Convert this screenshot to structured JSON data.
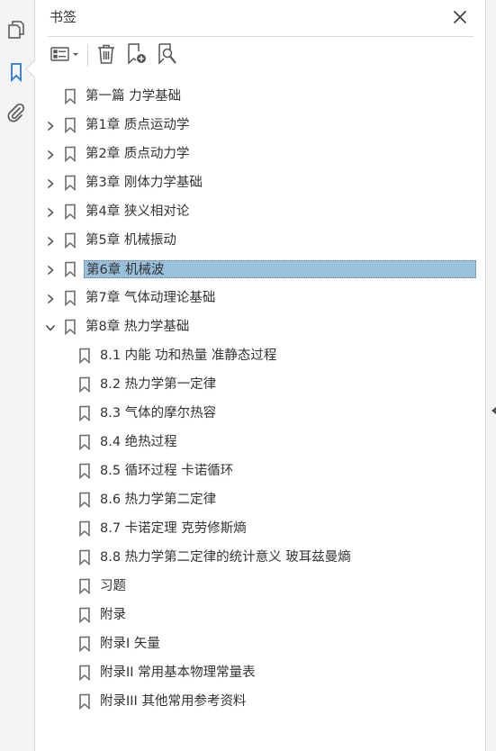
{
  "panel": {
    "title": "书签"
  },
  "rail": {
    "icons": [
      "pages-icon",
      "bookmark-icon",
      "attachment-icon"
    ]
  },
  "toolbar": {
    "buttons": [
      "options-menu-icon",
      "delete-bookmark-icon",
      "new-bookmark-icon",
      "find-bookmark-icon"
    ]
  },
  "bookmarks": [
    {
      "label": "第一篇  力学基础",
      "level": 0,
      "expander": "none"
    },
    {
      "label": "第1章  质点运动学",
      "level": 0,
      "expander": "collapsed"
    },
    {
      "label": "第2章  质点动力学",
      "level": 0,
      "expander": "collapsed"
    },
    {
      "label": "第3章  刚体力学基础",
      "level": 0,
      "expander": "collapsed"
    },
    {
      "label": "第4章  狭义相对论",
      "level": 0,
      "expander": "collapsed"
    },
    {
      "label": "第5章  机械振动",
      "level": 0,
      "expander": "collapsed"
    },
    {
      "label": "第6章  机械波",
      "level": 0,
      "expander": "collapsed",
      "selected": true
    },
    {
      "label": "第7章  气体动理论基础",
      "level": 0,
      "expander": "collapsed"
    },
    {
      "label": "第8章  热力学基础",
      "level": 0,
      "expander": "expanded"
    },
    {
      "label": "8.1  内能  功和热量  准静态过程",
      "level": 1,
      "expander": "none"
    },
    {
      "label": "8.2  热力学第一定律",
      "level": 1,
      "expander": "none"
    },
    {
      "label": "8.3  气体的摩尔热容",
      "level": 1,
      "expander": "none"
    },
    {
      "label": "8.4  绝热过程",
      "level": 1,
      "expander": "none"
    },
    {
      "label": "8.5  循环过程  卡诺循环",
      "level": 1,
      "expander": "none"
    },
    {
      "label": "8.6  热力学第二定律",
      "level": 1,
      "expander": "none"
    },
    {
      "label": "8.7  卡诺定理  克劳修斯熵",
      "level": 1,
      "expander": "none"
    },
    {
      "label": "8.8  热力学第二定律的统计意义  玻耳兹曼熵",
      "level": 1,
      "expander": "none"
    },
    {
      "label": "习题",
      "level": 1,
      "expander": "none"
    },
    {
      "label": "附录",
      "level": 1,
      "expander": "none"
    },
    {
      "label": "附录I  矢量",
      "level": 1,
      "expander": "none"
    },
    {
      "label": "附录II  常用基本物理常量表",
      "level": 1,
      "expander": "none"
    },
    {
      "label": "附录III  其他常用参考资料",
      "level": 1,
      "expander": "none"
    }
  ]
}
